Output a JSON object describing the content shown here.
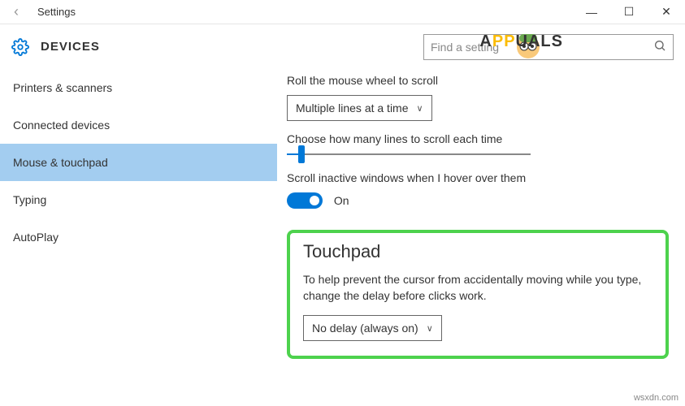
{
  "window": {
    "title": "Settings",
    "back_icon": "‹",
    "controls": {
      "min": "—",
      "max": "☐",
      "close": "✕"
    }
  },
  "header": {
    "title": "DEVICES",
    "search_placeholder": "Find a setting"
  },
  "sidebar": {
    "items": [
      {
        "label": "Printers & scanners",
        "selected": false
      },
      {
        "label": "Connected devices",
        "selected": false
      },
      {
        "label": "Mouse & touchpad",
        "selected": true
      },
      {
        "label": "Typing",
        "selected": false
      },
      {
        "label": "AutoPlay",
        "selected": false
      }
    ]
  },
  "main": {
    "scroll_label": "Roll the mouse wheel to scroll",
    "scroll_dropdown": "Multiple lines at a time",
    "lines_label": "Choose how many lines to scroll each time",
    "inactive_label": "Scroll inactive windows when I hover over them",
    "toggle_state": "On",
    "touchpad": {
      "heading": "Touchpad",
      "description": "To help prevent the cursor from accidentally moving while you type, change the delay before clicks work.",
      "dropdown": "No delay (always on)"
    }
  },
  "watermark": {
    "brand_a": "A",
    "brand_pp": "PP",
    "brand_uals": "UALS"
  },
  "attribution": "wsxdn.com"
}
